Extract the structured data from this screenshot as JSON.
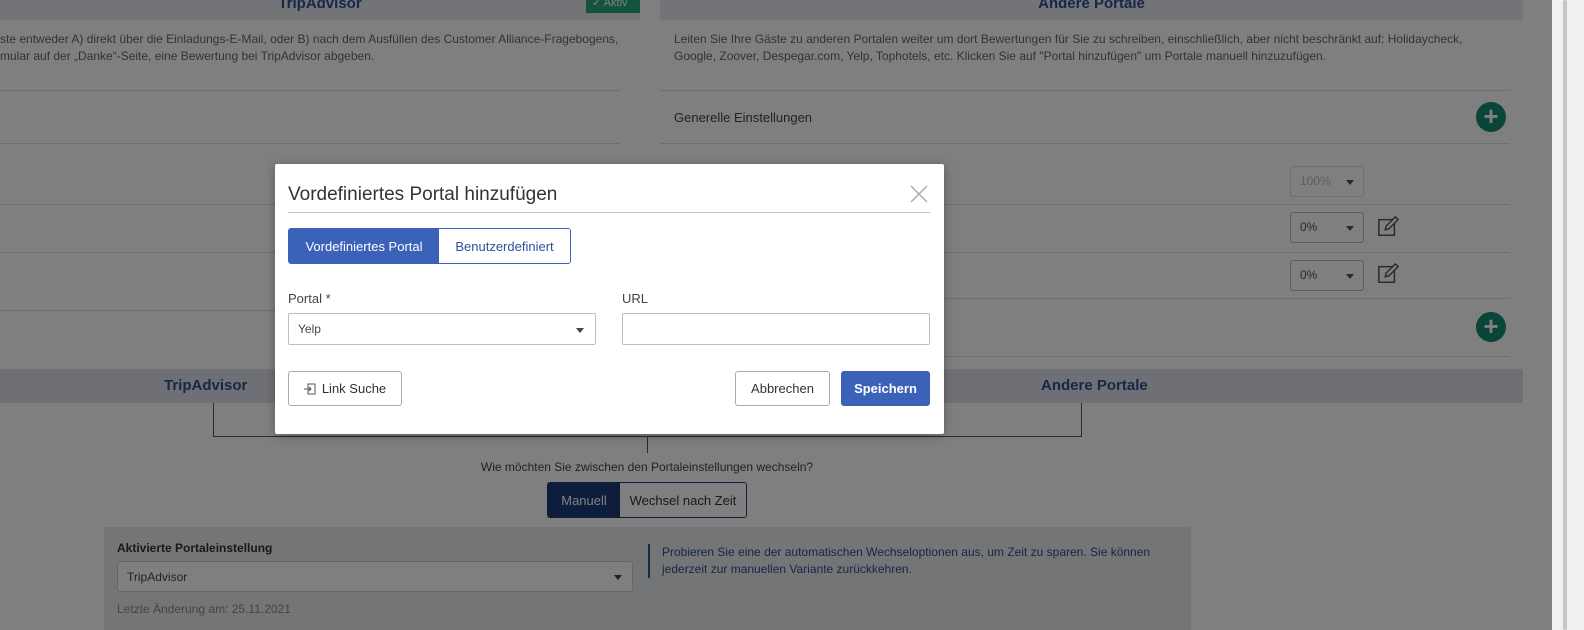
{
  "background": {
    "left_column": {
      "header": "TripAdvisor",
      "badge": "Aktiv",
      "description_line1": "ste entweder A) direkt über die Einladungs-E-Mail, oder B) nach dem Ausfüllen des Customer Alliance-Fragebogens,",
      "description_line2": "mular auf der „Danke“-Seite, eine Bewertung bei TripAdvisor abgeben."
    },
    "right_column": {
      "header": "Andere Portale",
      "description_line1": "Leiten Sie Ihre Gäste zu anderen Portalen weiter um dort Bewertungen für Sie zu schreiben, einschließlich, aber nicht beschränkt auf: Holidaycheck,",
      "description_line2": "Google, Zoover, Despegar.com, Yelp, Tophotels, etc. Klicken Sie auf \"Portal hinzufügen\" um Portale manuell hinzuzufügen.",
      "general_settings": "Generelle Einstellungen",
      "pct_rows": [
        "100%",
        "0%",
        "0%"
      ]
    },
    "lower_headers": {
      "left": "TripAdvisor",
      "right": "Andere Portale"
    },
    "switch_question": "Wie möchten Sie zwischen den Portaleinstellungen wechseln?",
    "switch_options": {
      "manual": "Manuell",
      "timed": "Wechsel nach Zeit"
    },
    "active_setting": {
      "label": "Aktivierte Portaleinstellung",
      "value": "TripAdvisor",
      "last_change": "Letzte Änderung am: 25.11.2021"
    },
    "info_text": "Probieren Sie eine der automatischen Wechseloptionen aus, um Zeit zu sparen. Sie können jederzeit zur manuellen Variante zurückkehren."
  },
  "modal": {
    "title": "Vordefiniertes Portal hinzufügen",
    "tabs": {
      "predefined": "Vordefiniertes Portal",
      "custom": "Benutzerdefiniert"
    },
    "portal_label": "Portal *",
    "portal_value": "Yelp",
    "url_label": "URL",
    "url_value": "",
    "link_search": "Link Suche",
    "cancel": "Abbrechen",
    "save": "Speichern"
  },
  "colors": {
    "primary": "#3b62b8",
    "accent_green": "#138a72",
    "header_text": "#2f4f8f"
  }
}
